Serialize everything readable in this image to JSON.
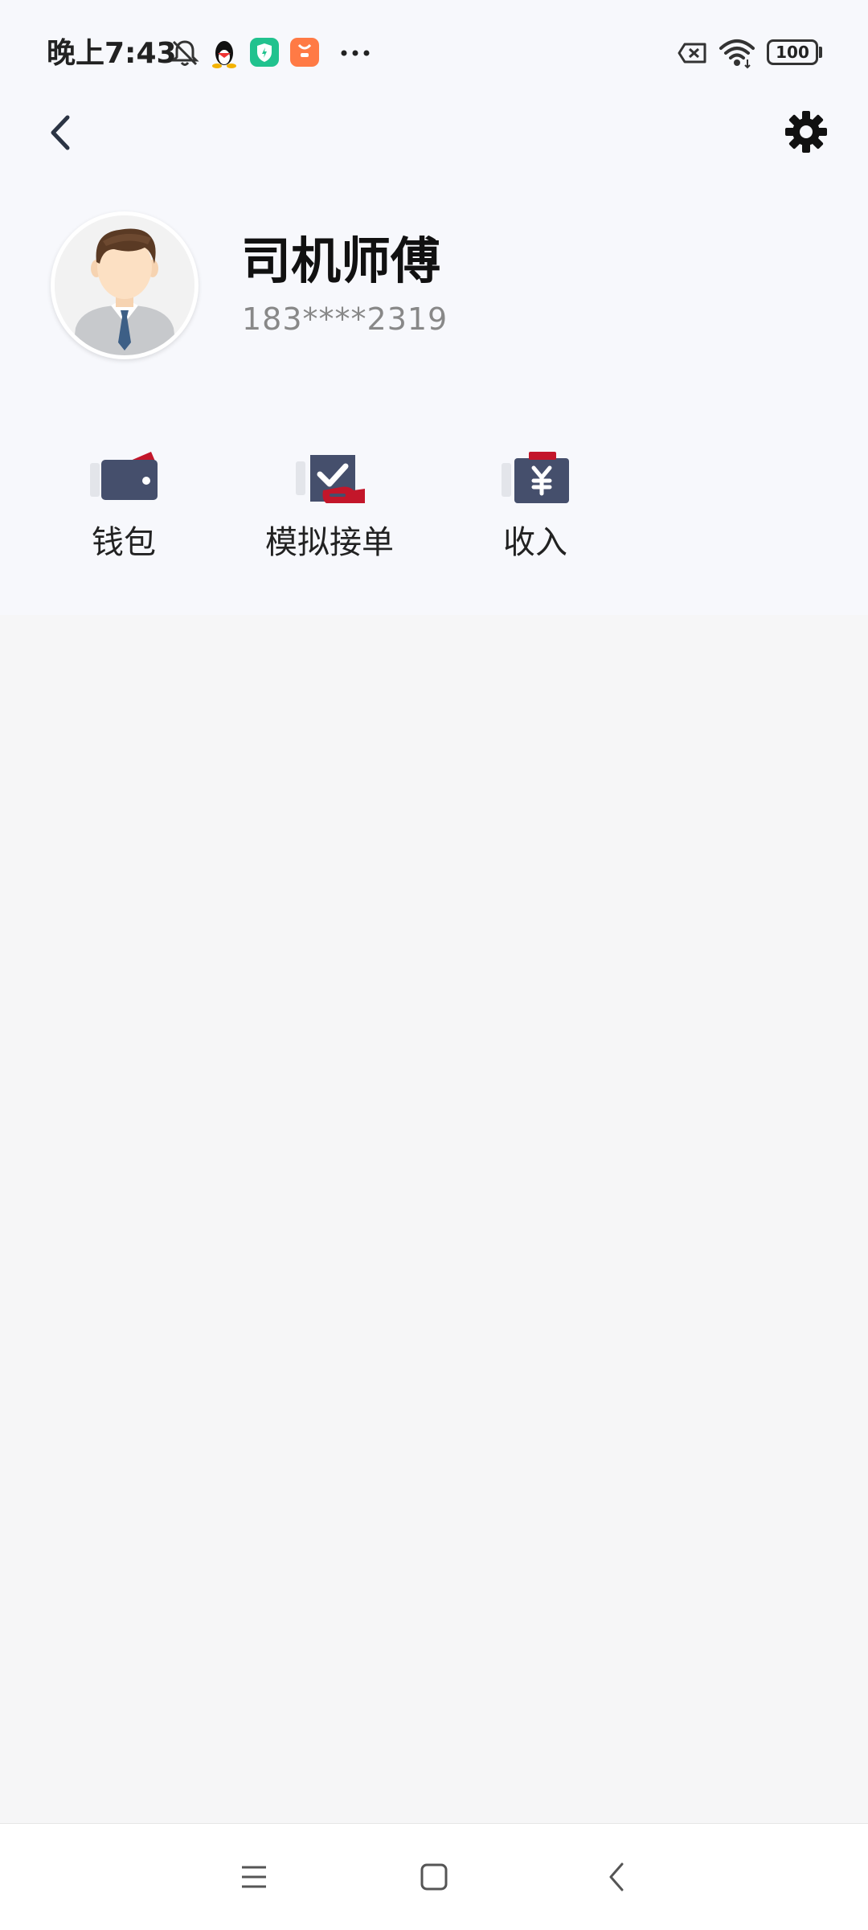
{
  "status_bar": {
    "time": "晚上7:43",
    "battery": "100",
    "icons": [
      "bell-muted-icon",
      "qq-icon",
      "shield-app-icon",
      "shopping-app-icon",
      "more-dots-icon",
      "sim-error-icon",
      "wifi-icon",
      "battery-icon"
    ]
  },
  "header": {
    "back_icon": "chevron-left-icon",
    "settings_icon": "gear-icon"
  },
  "profile": {
    "name": "司机师傅",
    "phone": "183****2319"
  },
  "actions": [
    {
      "label": "钱包",
      "icon": "wallet-icon"
    },
    {
      "label": "模拟接单",
      "icon": "order-check-icon"
    },
    {
      "label": "收入",
      "icon": "income-yuan-icon"
    }
  ],
  "colors": {
    "icon_navy": "#454f6c",
    "icon_red": "#c3162a",
    "icon_gray": "#e3e5ea",
    "top_background": "#f7f8fc",
    "page_background": "#f6f6f7"
  },
  "nav_bar": {
    "icons": [
      "menu-icon",
      "home-square-icon",
      "back-triangle-icon"
    ]
  }
}
